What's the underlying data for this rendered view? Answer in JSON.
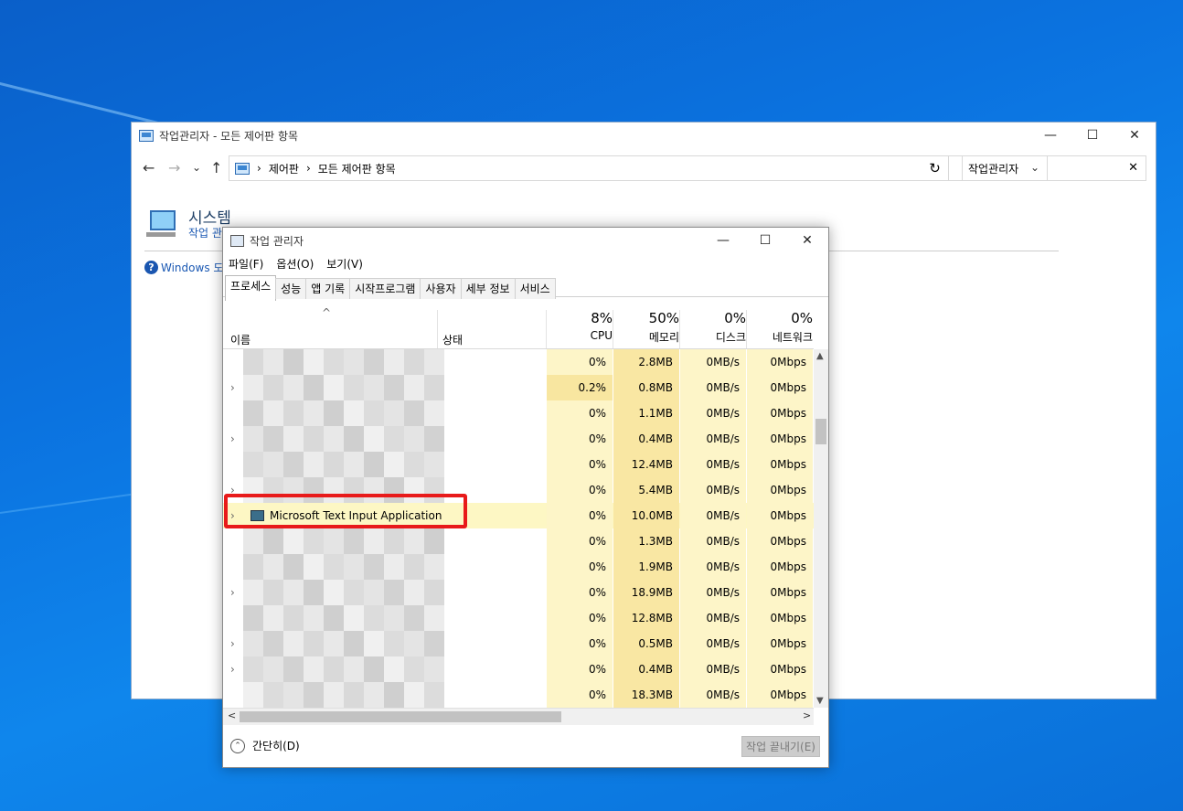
{
  "control_panel": {
    "title": "작업관리자 - 모든 제어판 항목",
    "nav": {
      "back": "←",
      "forward": "→",
      "recent": "⌄",
      "up": "↑"
    },
    "address": [
      "제어판",
      "모든 제어판 항목"
    ],
    "address_sep": "›",
    "address_dropdown": "⌄",
    "refresh": "↻",
    "search_value": "작업관리자",
    "search_clear": "✕",
    "system_title": "시스템",
    "system_link": "작업 관리자",
    "help_mark": "?",
    "help_text": "Windows 도",
    "window_controls": {
      "minimize": "—",
      "maximize": "☐",
      "close": "✕"
    }
  },
  "task_manager": {
    "title": "작업 관리자",
    "window_controls": {
      "minimize": "—",
      "maximize": "☐",
      "close": "✕"
    },
    "menu": [
      "파일(F)",
      "옵션(O)",
      "보기(V)"
    ],
    "tabs": [
      "프로세스",
      "성능",
      "앱 기록",
      "시작프로그램",
      "사용자",
      "세부 정보",
      "서비스"
    ],
    "active_tab": 0,
    "header": {
      "sort_caret": "^",
      "name": "이름",
      "status": "상태",
      "metrics": [
        {
          "pct": "8%",
          "label": "CPU"
        },
        {
          "pct": "50%",
          "label": "메모리"
        },
        {
          "pct": "0%",
          "label": "디스크"
        },
        {
          "pct": "0%",
          "label": "네트워크"
        }
      ]
    },
    "expand_glyph": "›",
    "rows": [
      {
        "expand": false,
        "name": "",
        "cpu": "0%",
        "mem": "2.8MB",
        "disk": "0MB/s",
        "net": "0Mbps"
      },
      {
        "expand": true,
        "name": "",
        "cpu": "0.2%",
        "mem": "0.8MB",
        "disk": "0MB/s",
        "net": "0Mbps"
      },
      {
        "expand": false,
        "name": "",
        "cpu": "0%",
        "mem": "1.1MB",
        "disk": "0MB/s",
        "net": "0Mbps"
      },
      {
        "expand": true,
        "name": "",
        "cpu": "0%",
        "mem": "0.4MB",
        "disk": "0MB/s",
        "net": "0Mbps"
      },
      {
        "expand": false,
        "name": "",
        "cpu": "0%",
        "mem": "12.4MB",
        "disk": "0MB/s",
        "net": "0Mbps"
      },
      {
        "expand": true,
        "name": "",
        "cpu": "0%",
        "mem": "5.4MB",
        "disk": "0MB/s",
        "net": "0Mbps"
      },
      {
        "expand": true,
        "name": "Microsoft Text Input Application",
        "cpu": "0%",
        "mem": "10.0MB",
        "disk": "0MB/s",
        "net": "0Mbps",
        "highlighted": true
      },
      {
        "expand": false,
        "name": "",
        "cpu": "0%",
        "mem": "1.3MB",
        "disk": "0MB/s",
        "net": "0Mbps"
      },
      {
        "expand": false,
        "name": "",
        "cpu": "0%",
        "mem": "1.9MB",
        "disk": "0MB/s",
        "net": "0Mbps"
      },
      {
        "expand": true,
        "name": "",
        "cpu": "0%",
        "mem": "18.9MB",
        "disk": "0MB/s",
        "net": "0Mbps"
      },
      {
        "expand": false,
        "name": "",
        "cpu": "0%",
        "mem": "12.8MB",
        "disk": "0MB/s",
        "net": "0Mbps"
      },
      {
        "expand": true,
        "name": "",
        "cpu": "0%",
        "mem": "0.5MB",
        "disk": "0MB/s",
        "net": "0Mbps"
      },
      {
        "expand": true,
        "name": "",
        "cpu": "0%",
        "mem": "0.4MB",
        "disk": "0MB/s",
        "net": "0Mbps"
      },
      {
        "expand": false,
        "name": "",
        "cpu": "0%",
        "mem": "18.3MB",
        "disk": "0MB/s",
        "net": "0Mbps"
      }
    ],
    "scroll": {
      "up": "▲",
      "down": "▼",
      "left": "<",
      "right": ">"
    },
    "footer": {
      "fewer_details": "간단히(D)",
      "fewer_icon": "⌃",
      "end_task": "작업 끝내기(E)"
    },
    "colors": {
      "cpu_bg": "#fdf5c8",
      "cpu_bg_hot": "#f8e6a0",
      "mem_bg": "#f9e7a3",
      "disk_bg": "#fdf5c8",
      "net_bg": "#fdf5c8",
      "highlight_row": "#fdf7c4",
      "callout": "#e81a1a"
    }
  }
}
